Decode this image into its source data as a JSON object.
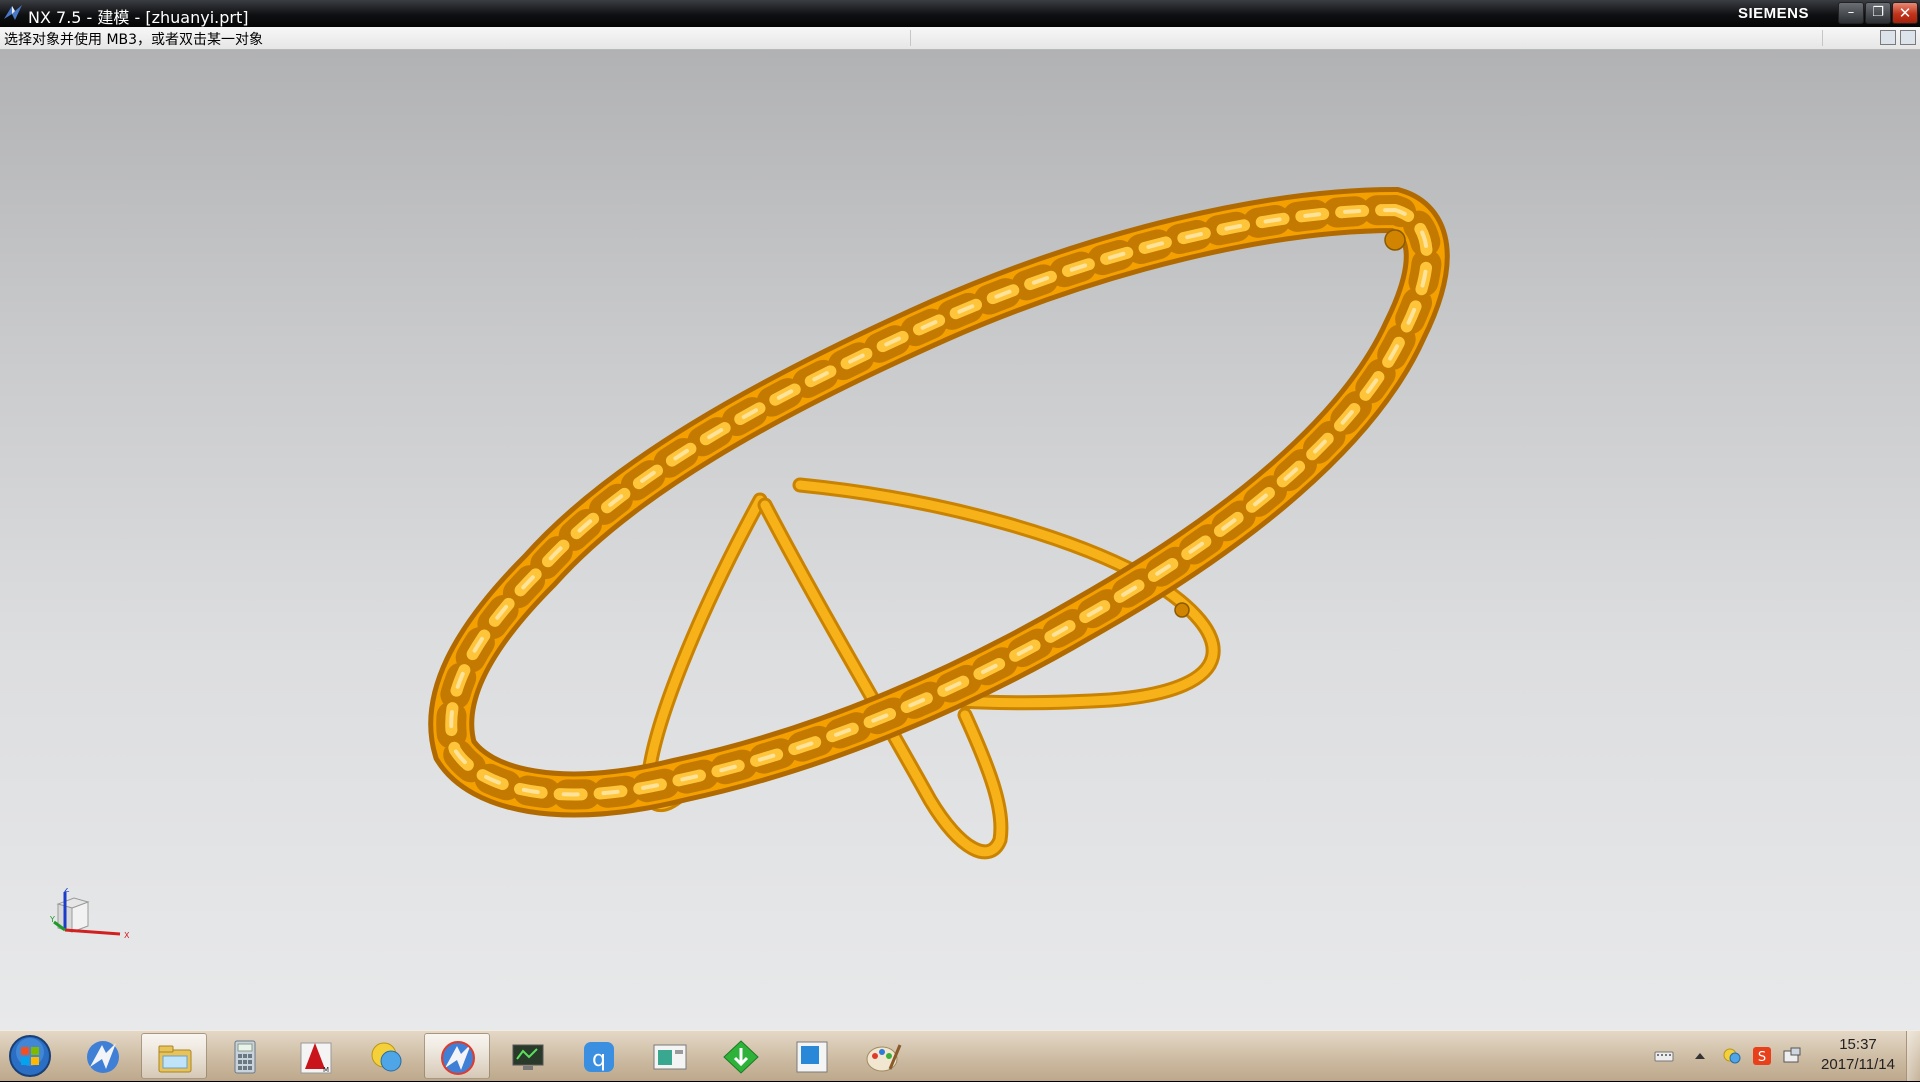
{
  "window": {
    "title": "NX 7.5 - 建模 - [zhuanyi.prt]",
    "brand": "SIEMENS",
    "controls": {
      "minimize": "–",
      "restore": "❐",
      "close": "✕"
    }
  },
  "status": {
    "prompt": "选择对象并使用 MB3，或者双击某一对象"
  },
  "viewport": {
    "model_color": "#f5a400",
    "triad": {
      "x_label": "X",
      "y_label": "Y",
      "z_label": "Z"
    }
  },
  "taskbar": {
    "apps": [
      {
        "name": "start-orb-icon"
      },
      {
        "name": "nx-icon"
      },
      {
        "name": "file-explorer-icon"
      },
      {
        "name": "calculator-icon"
      },
      {
        "name": "autocad-icon"
      },
      {
        "name": "chat-icon"
      },
      {
        "name": "nx-active-icon",
        "active": true
      },
      {
        "name": "monitor-app-icon"
      },
      {
        "name": "qq-icon"
      },
      {
        "name": "window-app-icon"
      },
      {
        "name": "download-icon"
      },
      {
        "name": "blue-window-icon"
      },
      {
        "name": "paint-icon"
      }
    ],
    "tray": [
      "keyboard-icon",
      "show-hidden-icon",
      "network-icon",
      "sogou-ime-icon",
      "notification-icon"
    ],
    "clock": {
      "time": "15:37",
      "date": "2017/11/14"
    }
  }
}
